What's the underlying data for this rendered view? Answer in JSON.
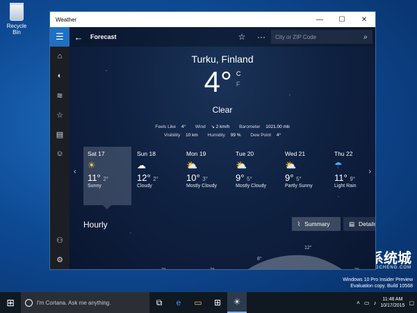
{
  "desktop": {
    "recycle_label": "Recycle Bin"
  },
  "window": {
    "title": "Weather",
    "min": "—",
    "max": "☐",
    "close": "✕"
  },
  "topbar": {
    "title": "Forecast",
    "back": "←",
    "star": "☆",
    "more": "···",
    "search_placeholder": "City or ZIP Code",
    "search_icon": "⌕"
  },
  "rail": [
    "☰",
    "⌂",
    "◐",
    "≋",
    "☆",
    "▤",
    "☺",
    "⚇",
    "⚙"
  ],
  "current": {
    "location": "Turku, Finland",
    "temp": "4°",
    "unit_c": "C",
    "unit_f": "F",
    "condition": "Clear",
    "feels_label": "Feels Like",
    "feels": "4°",
    "wind_label": "Wind",
    "wind": "↘ 2 km/h",
    "baro_label": "Barometer",
    "baro": "1021.00 mb",
    "vis_label": "Visibility",
    "vis": "10 km",
    "hum_label": "Humidity",
    "hum": "99 %",
    "dew_label": "Dew Point",
    "dew": "4°"
  },
  "days": [
    {
      "name": "Sat 17",
      "icon": "☀",
      "hi": "11°",
      "lo": "2°",
      "cond": "Sunny"
    },
    {
      "name": "Sun 18",
      "icon": "☁",
      "hi": "12°",
      "lo": "2°",
      "cond": "Cloudy"
    },
    {
      "name": "Mon 19",
      "icon": "⛅",
      "hi": "10°",
      "lo": "3°",
      "cond": "Mostly Cloudy"
    },
    {
      "name": "Tue 20",
      "icon": "⛅",
      "hi": "9°",
      "lo": "5°",
      "cond": "Mostly Cloudy"
    },
    {
      "name": "Wed 21",
      "icon": "⛅",
      "hi": "9°",
      "lo": "5°",
      "cond": "Partly Sunny"
    },
    {
      "name": "Thu 22",
      "icon": "☂",
      "hi": "11°",
      "lo": "9°",
      "cond": "Light Rain"
    }
  ],
  "hourly": {
    "label": "Hourly",
    "summary": "Summary",
    "details": "Details",
    "temps": [
      "2°",
      "3°",
      "3°",
      "8°",
      "12°",
      "3°"
    ]
  },
  "taskbar": {
    "cortana": "I'm Cortana. Ask me anything.",
    "time": "11:48 AM",
    "date": "10/17/2015"
  },
  "watermark": {
    "line1": "Windows 10 Pro Insider Preview",
    "line2": "Evaluation copy. Build 10568",
    "logo_mark": "X",
    "logo_cn": "系统城",
    "logo_sub": "XITONGCHENG.COM"
  }
}
